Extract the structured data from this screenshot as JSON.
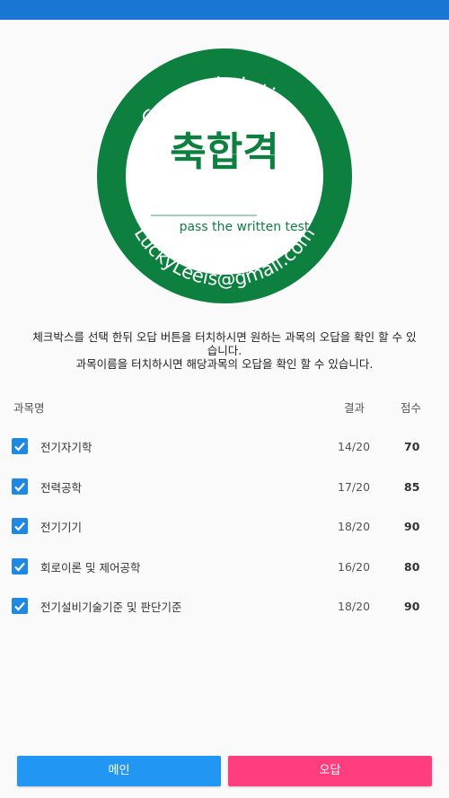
{
  "seal": {
    "arc_top": "Congratulations",
    "center": "축합격",
    "tagline": "pass the written test",
    "arc_bottom": "LuckyLeeis@gmail.com",
    "color": "#0d8040"
  },
  "instructions": {
    "line1": "체크박스를 선택 한뒤 오답 버튼을 터치하시면 원하는 과목의 오답을 확인 할 수 있",
    "line2": "습니다.",
    "line3": "과목이름을 터치하시면 해당과목의 오답을 확인 할 수 있습니다."
  },
  "table": {
    "headers": {
      "name": "과목명",
      "result": "결과",
      "score": "점수"
    },
    "rows": [
      {
        "subject": "전기자기학",
        "result": "14/20",
        "score": "70",
        "checked": true
      },
      {
        "subject": "전력공학",
        "result": "17/20",
        "score": "85",
        "checked": true
      },
      {
        "subject": "전기기기",
        "result": "18/20",
        "score": "90",
        "checked": true
      },
      {
        "subject": "회로이론 및 제어공학",
        "result": "16/20",
        "score": "80",
        "checked": true
      },
      {
        "subject": "전기설비기술기준 및 판단기준",
        "result": "18/20",
        "score": "90",
        "checked": true
      }
    ]
  },
  "buttons": {
    "main": "메인",
    "review": "오답"
  },
  "colors": {
    "status_bar": "#1976d2",
    "checkbox": "#1e88e5",
    "main_button": "#2196f3",
    "review_button": "#ff3d7f"
  }
}
